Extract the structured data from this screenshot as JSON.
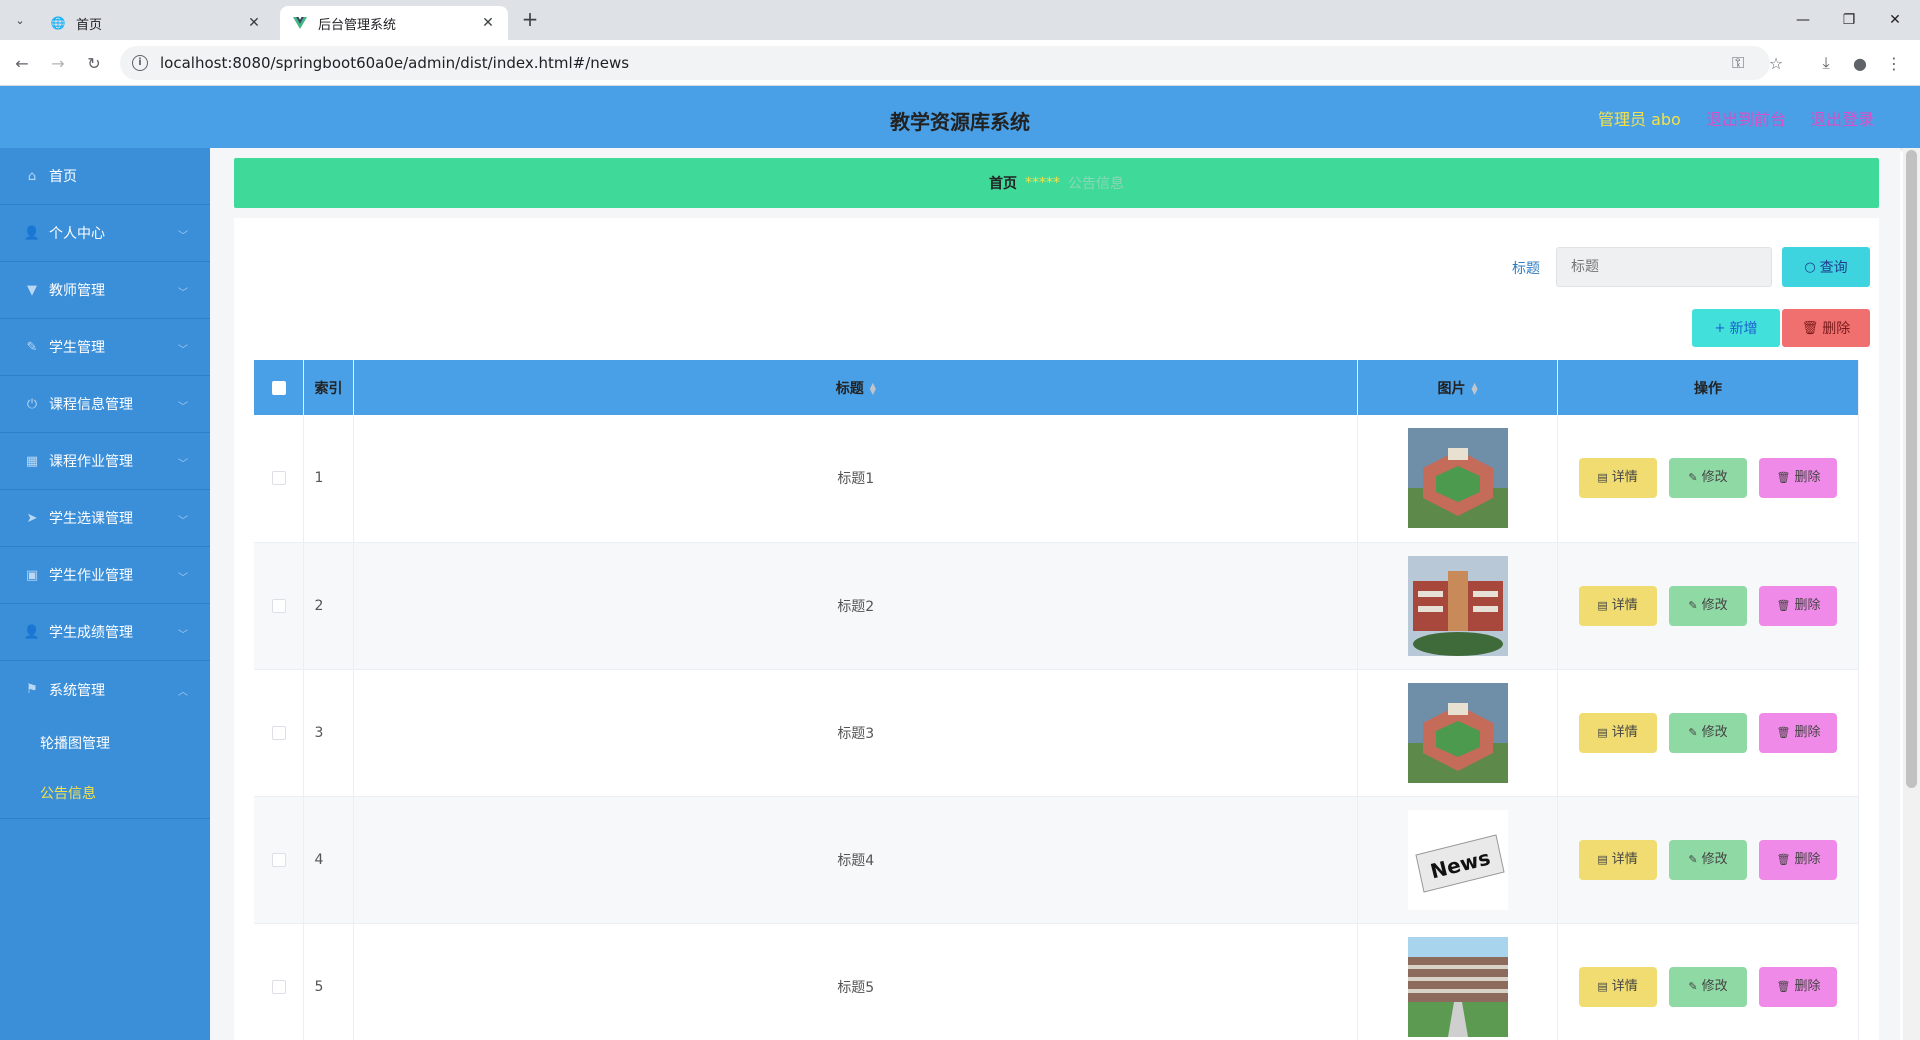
{
  "browser": {
    "tabs": [
      {
        "title": "首页",
        "active": false
      },
      {
        "title": "后台管理系统",
        "active": true
      }
    ],
    "url": "localhost:8080/springboot60a0e/admin/dist/index.html#/news"
  },
  "header": {
    "title": "教学资源库系统",
    "user": "管理员 abo",
    "links": [
      "退出到前台",
      "退出登录"
    ]
  },
  "sidebar": {
    "items": [
      {
        "label": "首页",
        "icon": "home-icon"
      },
      {
        "label": "个人中心",
        "icon": "user-icon"
      },
      {
        "label": "教师管理",
        "icon": "teacher-icon"
      },
      {
        "label": "学生管理",
        "icon": "student-icon"
      },
      {
        "label": "课程信息管理",
        "icon": "power-icon"
      },
      {
        "label": "课程作业管理",
        "icon": "grid-icon"
      },
      {
        "label": "学生选课管理",
        "icon": "send-icon"
      },
      {
        "label": "学生作业管理",
        "icon": "clipboard-icon"
      },
      {
        "label": "学生成绩管理",
        "icon": "user-icon"
      },
      {
        "label": "系统管理",
        "icon": "flag-icon"
      }
    ],
    "subitems": [
      {
        "label": "轮播图管理",
        "active": false
      },
      {
        "label": "公告信息",
        "active": true
      }
    ]
  },
  "breadcrumb": {
    "home": "首页",
    "separator": "*****",
    "current": "公告信息"
  },
  "search": {
    "label": "标题",
    "placeholder": "标题",
    "button": "查询"
  },
  "actions": {
    "add": "新增",
    "delete": "删除"
  },
  "table": {
    "headers": {
      "index": "索引",
      "title": "标题",
      "image": "图片",
      "ops": "操作"
    },
    "rows": [
      {
        "index": "1",
        "title": "标题1",
        "image": "school-building-photo"
      },
      {
        "index": "2",
        "title": "标题2",
        "image": "campus-gate-photo"
      },
      {
        "index": "3",
        "title": "标题3",
        "image": "school-building-photo"
      },
      {
        "index": "4",
        "title": "标题4",
        "image": "news-newspaper-photo",
        "image_text": "News"
      },
      {
        "index": "5",
        "title": "标题5",
        "image": "campus-courtyard-photo"
      }
    ],
    "row_ops": {
      "detail": "详情",
      "edit": "修改",
      "remove": "删除"
    }
  },
  "colors": {
    "header_bg": "#4aa0e6",
    "sidebar_bg": "#3b8fd9",
    "breadcrumb_bg": "#3fd99a",
    "detail_btn": "#f0dc70",
    "edit_btn": "#8fd9a4",
    "remove_btn": "#f08ae8"
  }
}
